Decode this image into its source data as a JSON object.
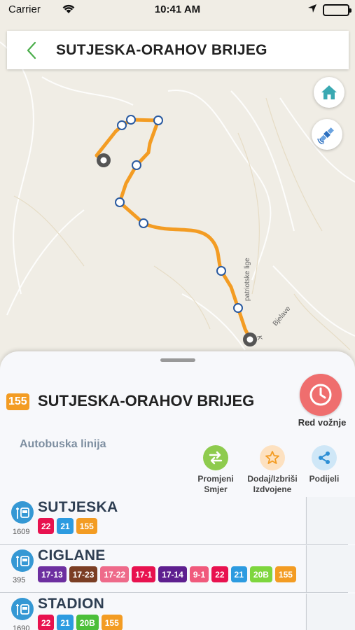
{
  "status_bar": {
    "carrier": "Carrier",
    "time": "10:41 AM"
  },
  "header": {
    "title": "SUTJESKA-ORAHOV BRIJEG"
  },
  "map": {
    "street_labels": [
      "patriotske lige",
      "Bjelave",
      "K"
    ],
    "route_color": "#f39c23"
  },
  "sheet": {
    "line_number": "155",
    "line_title": "SUTJESKA-ORAHOV BRIJEG",
    "timetable_label": "Red vožnje",
    "bus_line_label": "Autobuska linija",
    "actions": [
      {
        "label1": "Promjeni",
        "label2": "Smjer",
        "icon": "swap-icon",
        "color": "#8ecb4e"
      },
      {
        "label1": "Dodaj/Izbriši",
        "label2": "Izdvojene",
        "icon": "star-icon",
        "color": "#fde1c0"
      },
      {
        "label1": "Podijeli",
        "label2": "",
        "icon": "share-icon",
        "color": "#cfe7f7"
      }
    ],
    "stops": [
      {
        "name": "SUTJESKA",
        "number": "1609",
        "lines": [
          {
            "label": "22",
            "color": "#e8124f"
          },
          {
            "label": "21",
            "color": "#2d9be0"
          },
          {
            "label": "155",
            "color": "#f39c23"
          }
        ]
      },
      {
        "name": "CIGLANE",
        "number": "395",
        "lines": [
          {
            "label": "17-13",
            "color": "#6d2fa0"
          },
          {
            "label": "17-23",
            "color": "#7b3e24"
          },
          {
            "label": "17-22",
            "color": "#ee6a8a"
          },
          {
            "label": "17-1",
            "color": "#e8124f"
          },
          {
            "label": "17-14",
            "color": "#5e1f8f"
          },
          {
            "label": "9-1",
            "color": "#f05a7c"
          },
          {
            "label": "22",
            "color": "#e8124f"
          },
          {
            "label": "21",
            "color": "#2d9be0"
          },
          {
            "label": "20B",
            "color": "#7ed63e"
          },
          {
            "label": "155",
            "color": "#f39c23"
          }
        ]
      },
      {
        "name": "STADION",
        "number": "1690",
        "lines": [
          {
            "label": "22",
            "color": "#e8124f"
          },
          {
            "label": "21",
            "color": "#2d9be0"
          },
          {
            "label": "20B",
            "color": "#4cbf3a"
          },
          {
            "label": "155",
            "color": "#f39c23"
          }
        ]
      }
    ]
  }
}
